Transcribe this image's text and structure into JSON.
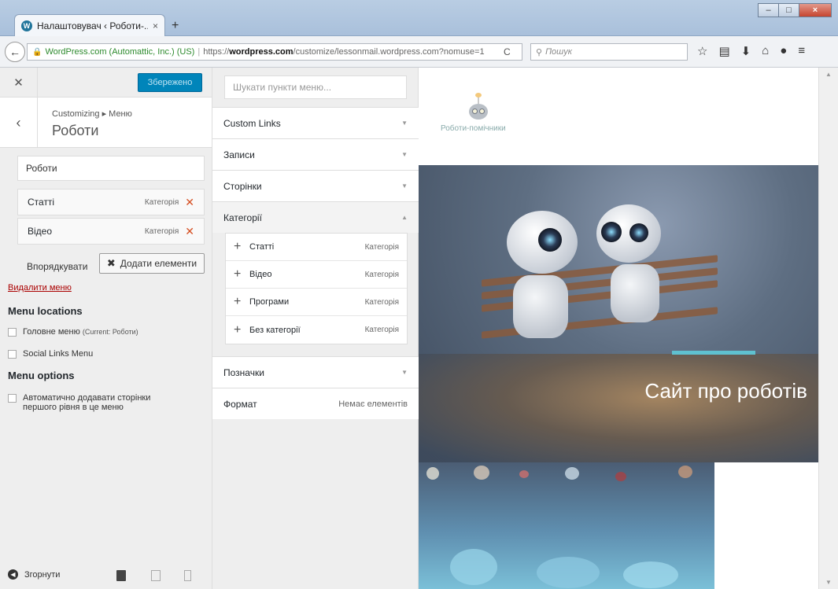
{
  "browser": {
    "tab_title": "Налаштовувач ‹ Роботи-...",
    "tab_close": "×",
    "new_tab": "+",
    "url_org": "WordPress.com (Automattic, Inc.) (US)",
    "url_prefix": "https://",
    "url_host": "wordpress.com",
    "url_path": "/customize/lessonmail.wordpress.com?nomuse=1",
    "search_placeholder": "Пошук"
  },
  "sidebar": {
    "saved_label": "Збережено",
    "breadcrumb": "Customizing ▸ Меню",
    "title": "Роботи",
    "menu_name": "Роботи",
    "menu_items": [
      {
        "title": "Статті",
        "type": "Категорія"
      },
      {
        "title": "Відео",
        "type": "Категорія"
      }
    ],
    "reorder_label": "Впорядкувати",
    "add_items_label": "Додати елементи",
    "delete_menu_label": "Видалити меню",
    "menu_locations_heading": "Menu locations",
    "location_primary": "Головне меню",
    "location_primary_note": "(Current: Роботи)",
    "location_social": "Social Links Menu",
    "menu_options_heading": "Menu options",
    "auto_add_line1": "Автоматично додавати сторінки",
    "auto_add_line2": "першого рівня в це меню",
    "collapse_label": "Згорнути"
  },
  "items_panel": {
    "search_placeholder": "Шукати пункти меню...",
    "sections": [
      {
        "label": "Custom Links"
      },
      {
        "label": "Записи"
      },
      {
        "label": "Сторінки"
      },
      {
        "label": "Категорії"
      },
      {
        "label": "Позначки"
      },
      {
        "label": "Формат",
        "note": "Немає елементів"
      }
    ],
    "categories": [
      {
        "name": "Статті",
        "type": "Категорія"
      },
      {
        "name": "Відео",
        "type": "Категорія"
      },
      {
        "name": "Програми",
        "type": "Категорія"
      },
      {
        "name": "Без категорії",
        "type": "Категорія"
      }
    ]
  },
  "preview": {
    "site_title": "Роботи-помічники",
    "hero_title": "Сайт про роботів"
  },
  "colors": {
    "accent": "#0085ba",
    "delete": "#d54e21",
    "hero_bar": "#5fc1d0"
  }
}
